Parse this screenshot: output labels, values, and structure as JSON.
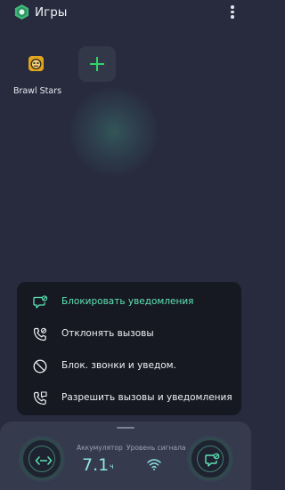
{
  "header": {
    "title": "Игры",
    "logo_icon": "shield-hexagon-logo",
    "more_icon": "more-vertical-icon"
  },
  "games": [
    {
      "label": "Brawl Stars",
      "icon": "brawl-stars-icon"
    }
  ],
  "add_game_icon": "plus-icon",
  "menu": {
    "items": [
      {
        "label": "Блокировать уведомления",
        "icon": "chat-bubble-block-icon",
        "active": true
      },
      {
        "label": "Отклонять вызовы",
        "icon": "phone-block-icon",
        "active": false
      },
      {
        "label": "Блок. звонки и уведом.",
        "icon": "circle-slash-icon",
        "active": false
      },
      {
        "label": "Разрешить вызовы и уведомления",
        "icon": "phone-chat-icon",
        "active": false
      }
    ]
  },
  "panel": {
    "battery_label": "Аккумулятор",
    "battery_value": "7.1",
    "battery_unit": "ч",
    "signal_label": "Уровень сигнала",
    "left_button_icon": "swap-arrows-icon",
    "right_button_icon": "chat-bubble-block-icon",
    "signal_icon": "wifi-icon"
  },
  "colors": {
    "background": "#272b3d",
    "accent_green": "#5fe3b4",
    "plus_green": "#2fd36a",
    "battery_value": "#8fe6e6"
  }
}
